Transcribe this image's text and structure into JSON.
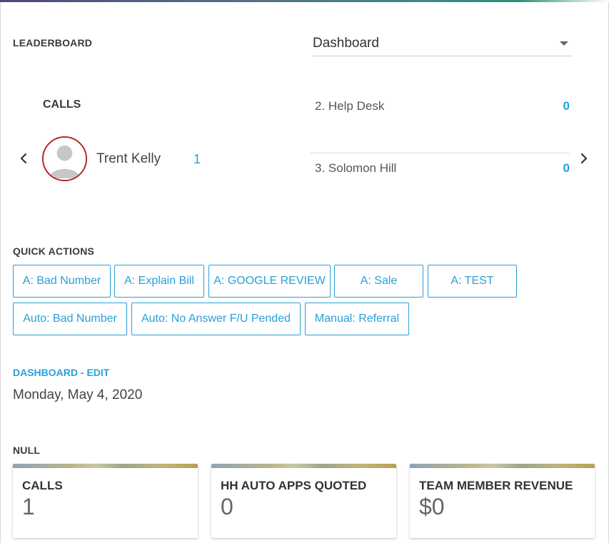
{
  "header": {
    "leaderboard_label": "LEADERBOARD",
    "dropdown_value": "Dashboard"
  },
  "leaderboard": {
    "metric": "CALLS",
    "leader": {
      "name": "Trent Kelly",
      "count": "1"
    },
    "ranks": [
      {
        "label": "2. Help Desk",
        "count": "0"
      },
      {
        "label": "3. Solomon Hill",
        "count": "0"
      }
    ]
  },
  "quick_actions": {
    "label": "QUICK ACTIONS",
    "buttons": [
      "A: Bad Number",
      "A: Explain Bill",
      "A: GOOGLE REVIEW",
      "A: Sale",
      "A: TEST",
      "Auto: Bad Number",
      "Auto: No Answer F/U Pended",
      "Manual: Referral"
    ]
  },
  "dashboard": {
    "edit_label": "DASHBOARD - EDIT",
    "date": "Monday, May 4, 2020"
  },
  "stats": {
    "group_label": "NULL",
    "cards": [
      {
        "title": "CALLS",
        "value": "1"
      },
      {
        "title": "HH AUTO APPS QUOTED",
        "value": "0"
      },
      {
        "title": "TEAM MEMBER REVENUE",
        "value": "$0"
      }
    ]
  },
  "colors": {
    "accent": "#2a9fd8",
    "avatar_ring": "#b3261e"
  },
  "icons": {
    "dropdown": "caret-down-icon",
    "prev": "chevron-left-icon",
    "next": "chevron-right-icon",
    "avatar": "user-placeholder-icon"
  }
}
